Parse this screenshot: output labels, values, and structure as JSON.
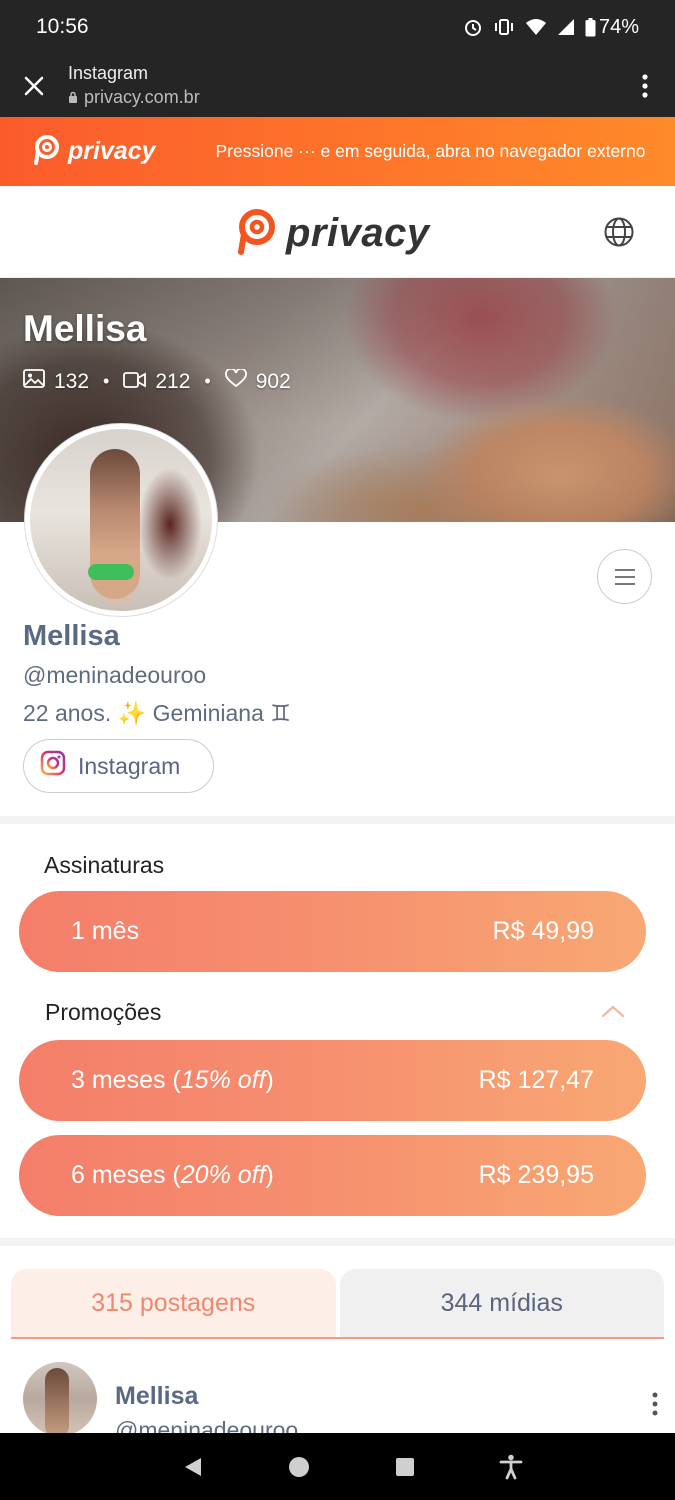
{
  "status_bar": {
    "time": "10:56",
    "battery": "74%"
  },
  "browser": {
    "title": "Instagram",
    "url": "privacy.com.br"
  },
  "banner": {
    "brand": "privacy",
    "message": "Pressione ··· e em seguida, abra no navegador externo"
  },
  "header": {
    "brand": "privacy"
  },
  "cover": {
    "name": "Mellisa",
    "stats": {
      "photos": "132",
      "videos": "212",
      "likes": "902"
    }
  },
  "profile": {
    "name": "Mellisa",
    "handle": "@meninadeouroo",
    "bio": "22 anos. ✨ Geminiana ♊",
    "instagram_label": "Instagram"
  },
  "subscriptions": {
    "title": "Assinaturas",
    "plans": [
      {
        "label": "1 mês",
        "price": "R$ 49,99"
      }
    ]
  },
  "promotions": {
    "title": "Promoções",
    "plans": [
      {
        "label": "3 meses",
        "discount": "15% off",
        "price": "R$ 127,47"
      },
      {
        "label": "6 meses",
        "discount": "20% off",
        "price": "R$ 239,95"
      }
    ]
  },
  "tabs": [
    {
      "label": "315 postagens",
      "active": true
    },
    {
      "label": "344 mídias",
      "active": false
    }
  ],
  "post": {
    "name": "Mellisa",
    "handle": "@meninadeouroo"
  },
  "colors": {
    "brand_orange": "#fb5b2b",
    "plan_gradient_start": "#f47e6a",
    "plan_gradient_end": "#f8a874",
    "tab_active_text": "#f0876f"
  },
  "icons": [
    "alarm-icon",
    "vibrate-icon",
    "wifi-icon",
    "signal-icon",
    "battery-icon",
    "close-icon",
    "lock-icon",
    "more-vert-icon",
    "privacy-logo-icon",
    "globe-icon",
    "image-icon",
    "video-icon",
    "heart-icon",
    "hamburger-icon",
    "instagram-icon",
    "chevron-up-icon",
    "back-icon",
    "home-icon",
    "recents-icon",
    "accessibility-icon"
  ]
}
